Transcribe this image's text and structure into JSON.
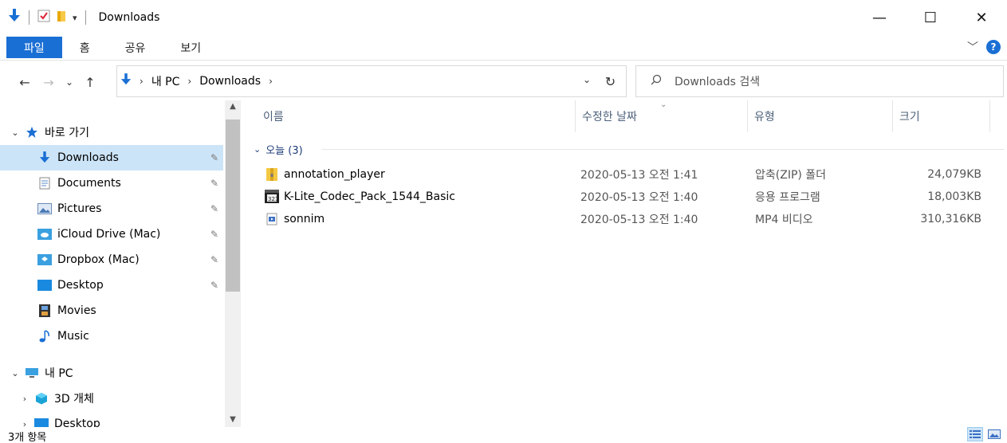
{
  "window": {
    "title": "Downloads",
    "minimize_label": "—",
    "maximize_label": "☐",
    "close_label": "✕",
    "qa_dropdown": "▾"
  },
  "ribbon": {
    "tabs": [
      {
        "label": "파일"
      },
      {
        "label": "홈"
      },
      {
        "label": "공유"
      },
      {
        "label": "보기"
      }
    ],
    "expand_glyph": "﹀",
    "help_label": "?"
  },
  "nav": {
    "back": "←",
    "forward": "→",
    "recent": "⌄",
    "up": "↑",
    "breadcrumb": [
      "내 PC",
      "Downloads"
    ],
    "breadcrumb_sep": "›",
    "dropdown": "⌄",
    "refresh": "↻",
    "search_placeholder": "Downloads 검색"
  },
  "sidebar": {
    "quick_access_label": "바로 가기",
    "items": [
      {
        "label": "Downloads",
        "icon": "download-arrow-icon",
        "pinned": true,
        "selected": true
      },
      {
        "label": "Documents",
        "icon": "document-icon",
        "pinned": true
      },
      {
        "label": "Pictures",
        "icon": "pictures-icon",
        "pinned": true
      },
      {
        "label": "iCloud Drive (Mac)",
        "icon": "icloud-icon",
        "pinned": true
      },
      {
        "label": "Dropbox (Mac)",
        "icon": "dropbox-icon",
        "pinned": true
      },
      {
        "label": "Desktop",
        "icon": "desktop-icon",
        "pinned": true
      },
      {
        "label": "Movies",
        "icon": "film-icon",
        "pinned": false
      },
      {
        "label": "Music",
        "icon": "music-note-icon",
        "pinned": false
      }
    ],
    "this_pc_label": "내 PC",
    "objects_3d_label": "3D 개체",
    "desktop_partial_label": "Desktop",
    "pin_glyph": "📌"
  },
  "columns": {
    "name": "이름",
    "date": "수정한 날짜",
    "type": "유형",
    "size": "크기",
    "sort_glyph": "⌄"
  },
  "group": {
    "label": "오늘 (3)",
    "chevron": "⌄"
  },
  "files": [
    {
      "name": "annotation_player",
      "date": "2020-05-13 오전 1:41",
      "type": "압축(ZIP) 폴더",
      "size": "24,079KB",
      "icon": "zip-folder-icon"
    },
    {
      "name": "K-Lite_Codec_Pack_1544_Basic",
      "date": "2020-05-13 오전 1:40",
      "type": "응용 프로그램",
      "size": "18,003KB",
      "icon": "application-icon"
    },
    {
      "name": "sonnim",
      "date": "2020-05-13 오전 1:40",
      "type": "MP4 비디오",
      "size": "310,316KB",
      "icon": "video-file-icon"
    }
  ],
  "status": {
    "count": "3개 항목"
  },
  "colors": {
    "accent": "#1a6fd4",
    "selection": "#cce4f7",
    "header_text": "#4c607a",
    "group_text": "#1e3c78"
  }
}
